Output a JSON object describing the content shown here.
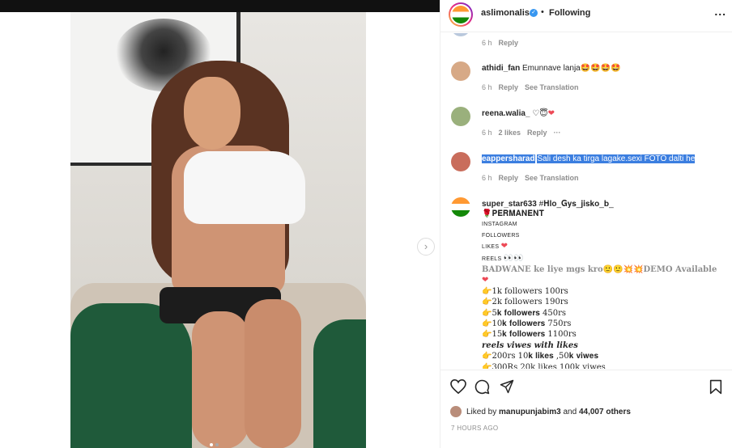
{
  "post": {
    "username": "aslimonalisa",
    "dot": "•",
    "follow_label": "Following",
    "more_label": "...",
    "next_label": "›"
  },
  "comments": [
    {
      "meta": {
        "time": "6 h",
        "reply": "Reply"
      }
    },
    {
      "user": "athidi_fan",
      "text": "Emunnave lanja",
      "emoji": "🤩🤩🤩🤩",
      "meta": {
        "time": "6 h",
        "reply": "Reply",
        "translate": "See Translation"
      }
    },
    {
      "user": "reena.walia_",
      "text": "♡😇",
      "heart": "❤",
      "meta": {
        "time": "6 h",
        "likes": "2 likes",
        "reply": "Reply",
        "more": "···"
      }
    },
    {
      "user": "eappersharad",
      "text": "Sali desh ka tirga lagake.sexi FOTO dalti he",
      "meta": {
        "time": "6 h",
        "reply": "Reply",
        "translate": "See Translation"
      }
    },
    {
      "user": "super_star633",
      "text": "#𝐇𝐥𝐨_𝐆𝐲𝐬_𝐣𝐢𝐬𝐤𝐨_𝐛_"
    }
  ],
  "promo": {
    "line1": "🌹𝐏𝐄𝐑𝐌𝐀𝐍𝐄𝐍𝐓",
    "line2": "INSTAGRAM",
    "line3": "FOLLOWERS",
    "line4a": "LIKES ",
    "line4b": "❤",
    "line5a": "REELS ",
    "line5b": "👀👀",
    "line6": "𝐁𝐀𝐃𝐖𝐀𝐍𝐄 𝐤𝐞 𝐥𝐢𝐲𝐞 𝐦𝐠𝐬 𝐤𝐫𝐨🙂🙂💥💥𝐃𝐄𝐌𝐎 𝐀𝐯𝐚𝐢𝐥𝐚𝐛𝐥𝐞",
    "line7": "❤",
    "prices": [
      "👉1k followers 100rs",
      "👉2k followers 190rs",
      "👉5𝐤 𝐟𝐨𝐥𝐥𝐨𝐰𝐞𝐫𝐬 450rs",
      "👉10𝐤 𝐟𝐨𝐥𝐥𝐨𝐰𝐞𝐫𝐬 750rs",
      "👉15𝐤 𝐟𝐨𝐥𝐥𝐨𝐰𝐞𝐫𝐬 1100rs"
    ],
    "reels_header": "𝒓𝒆𝒆𝒍𝒔 𝒗𝒊𝒘𝒆𝒔 𝒘𝒊𝒕𝒉 𝒍𝒊𝒌𝒆𝒔",
    "reel_prices": [
      "👉200rs 10𝐤 𝐥𝐢𝐤𝐞𝐬 ,50𝐤 𝐯𝐢𝐰𝐞𝐬",
      "👉300Rs 20k likes 100k viwes"
    ]
  },
  "footer": {
    "liked_by_prefix": "Liked by",
    "liked_user": "manupunjabim3",
    "and": "and",
    "others_count": "44,007 others",
    "timestamp": "7 HOURS AGO"
  },
  "carousel": {
    "dots": 2,
    "active": 0
  },
  "colors": {
    "accent": "#3897f0",
    "like": "#ed4956",
    "selection": "#3b7ee0"
  }
}
